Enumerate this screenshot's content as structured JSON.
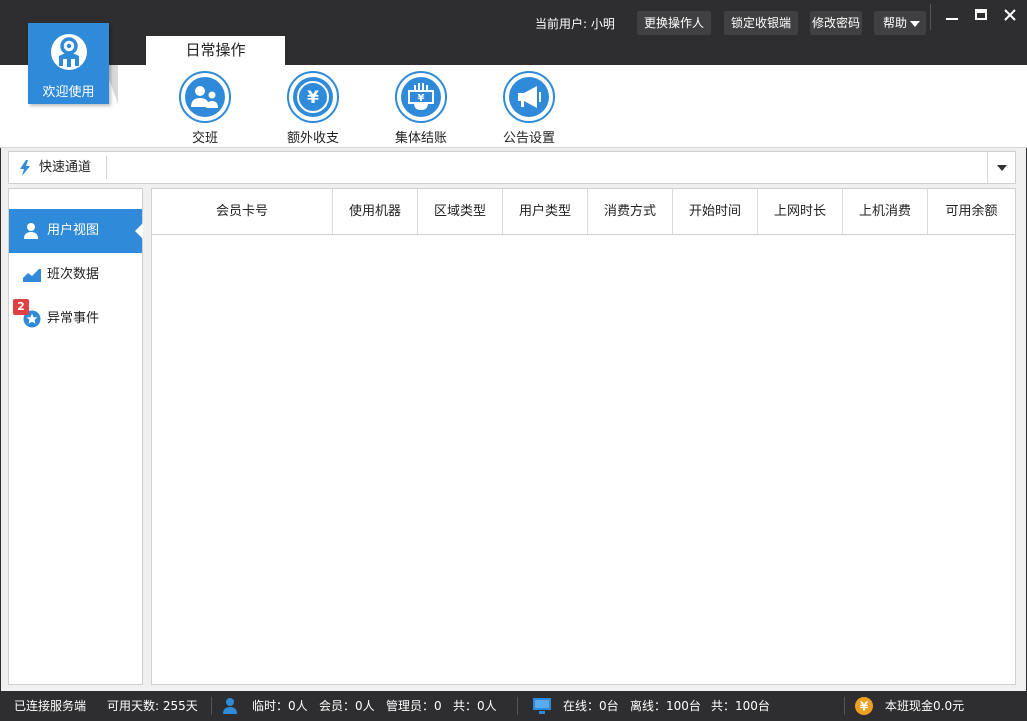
{
  "logo": {
    "label": "欢迎使用",
    "icon": "logo-emblem-icon"
  },
  "header": {
    "tab": "日常操作",
    "current_user_label": "当前用户: 小明",
    "buttons": {
      "change_operator": "更换操作人",
      "lock_terminal": "锁定收银端",
      "change_password": "修改密码",
      "help": "帮助"
    }
  },
  "toolbar": {
    "items": [
      {
        "label": "交班",
        "icon": "handover-icon"
      },
      {
        "label": "额外收支",
        "icon": "yen-coin-icon"
      },
      {
        "label": "集体结账",
        "icon": "group-checkout-icon"
      },
      {
        "label": "公告设置",
        "icon": "megaphone-icon"
      }
    ]
  },
  "quickbar": {
    "label": "快速通道",
    "icon": "lightning-icon"
  },
  "sidebar": {
    "items": [
      {
        "label": "用户视图",
        "icon": "user-icon",
        "active": true
      },
      {
        "label": "班次数据",
        "icon": "chart-icon",
        "active": false
      },
      {
        "label": "异常事件",
        "icon": "star-badge-icon",
        "active": false,
        "badge": "2"
      }
    ]
  },
  "table": {
    "columns": [
      "会员卡号",
      "使用机器",
      "区域类型",
      "用户类型",
      "消费方式",
      "开始时间",
      "上网时长",
      "上机消费",
      "可用余额"
    ],
    "rows": []
  },
  "status": {
    "connected": "已连接服务端",
    "days": "可用天数: 255天",
    "temp": "临时：0人",
    "member": "会员：0人",
    "admin": "管理员：0",
    "total_people": "共：0人",
    "online": "在线：0台",
    "offline": "离线：100台",
    "total_machines": "共：100台",
    "cash": "本班现金0.0元"
  },
  "colors": {
    "accent": "#2f8ad9",
    "dark": "#2e2e30",
    "badge": "#e04040",
    "coin": "#f0a020"
  }
}
